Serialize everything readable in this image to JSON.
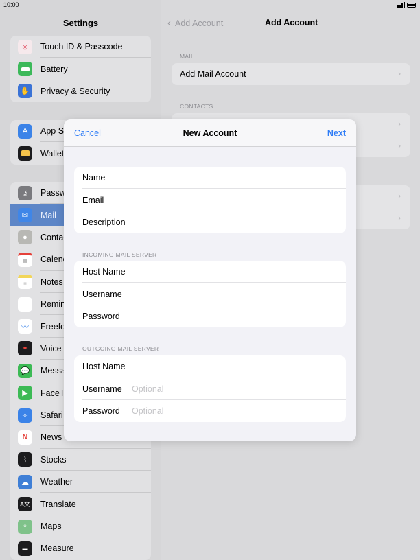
{
  "status": {
    "time": "10:00"
  },
  "sidebar": {
    "title": "Settings",
    "group1": [
      {
        "label": "Touch ID & Passcode",
        "icon": "fingerprint-icon",
        "color": "#f4e8ea"
      },
      {
        "label": "Battery",
        "icon": "battery-icon",
        "color": "#3cb95a"
      },
      {
        "label": "Privacy & Security",
        "icon": "hand-icon",
        "color": "#3b73d6"
      }
    ],
    "group2": [
      {
        "label": "App Store",
        "icon": "app-store-icon",
        "color": "#3b83e8"
      },
      {
        "label": "Wallet",
        "icon": "wallet-icon",
        "color": "#1c1c1e"
      }
    ],
    "group3": [
      {
        "label": "Passwords",
        "icon": "key-icon",
        "color": "#7a7a7e"
      },
      {
        "label": "Mail",
        "icon": "mail-icon",
        "color": "#3f86e8",
        "selected": true
      },
      {
        "label": "Contacts",
        "icon": "contacts-icon",
        "color": "#b8b8b4"
      },
      {
        "label": "Calendar",
        "icon": "calendar-icon",
        "color": "#f2f2f2"
      },
      {
        "label": "Notes",
        "icon": "notes-icon",
        "color": "#f2d65a"
      },
      {
        "label": "Reminders",
        "icon": "reminders-icon",
        "color": "#f2f2f2"
      },
      {
        "label": "Freeform",
        "icon": "freeform-icon",
        "color": "#f2f2f2"
      },
      {
        "label": "Voice Memos",
        "icon": "voice-memos-icon",
        "color": "#1c1c1e"
      },
      {
        "label": "Messages",
        "icon": "messages-icon",
        "color": "#3cba55"
      },
      {
        "label": "FaceTime",
        "icon": "facetime-icon",
        "color": "#3cba55"
      },
      {
        "label": "Safari",
        "icon": "safari-icon",
        "color": "#3b83e8"
      },
      {
        "label": "News",
        "icon": "news-icon",
        "color": "#f2f2f2"
      },
      {
        "label": "Stocks",
        "icon": "stocks-icon",
        "color": "#1c1c1e"
      },
      {
        "label": "Weather",
        "icon": "weather-icon",
        "color": "#3f7fd6"
      },
      {
        "label": "Translate",
        "icon": "translate-icon",
        "color": "#1c1c1e"
      },
      {
        "label": "Maps",
        "icon": "maps-icon",
        "color": "#7fc28a"
      },
      {
        "label": "Measure",
        "icon": "measure-icon",
        "color": "#1c1c1e"
      }
    ]
  },
  "right": {
    "back_label": "Add Account",
    "title": "Add Account",
    "mail_section": "MAIL",
    "mail_row": "Add Mail Account",
    "contacts_section": "CONTACTS"
  },
  "modal": {
    "cancel": "Cancel",
    "title": "New Account",
    "next": "Next",
    "account_fields": [
      "Name",
      "Email",
      "Description"
    ],
    "incoming_label": "INCOMING MAIL SERVER",
    "incoming_fields": [
      {
        "label": "Host Name",
        "placeholder": ""
      },
      {
        "label": "Username",
        "placeholder": ""
      },
      {
        "label": "Password",
        "placeholder": ""
      }
    ],
    "outgoing_label": "OUTGOING MAIL SERVER",
    "outgoing_fields": [
      {
        "label": "Host Name",
        "placeholder": ""
      },
      {
        "label": "Username",
        "placeholder": "Optional"
      },
      {
        "label": "Password",
        "placeholder": "Optional"
      }
    ]
  }
}
